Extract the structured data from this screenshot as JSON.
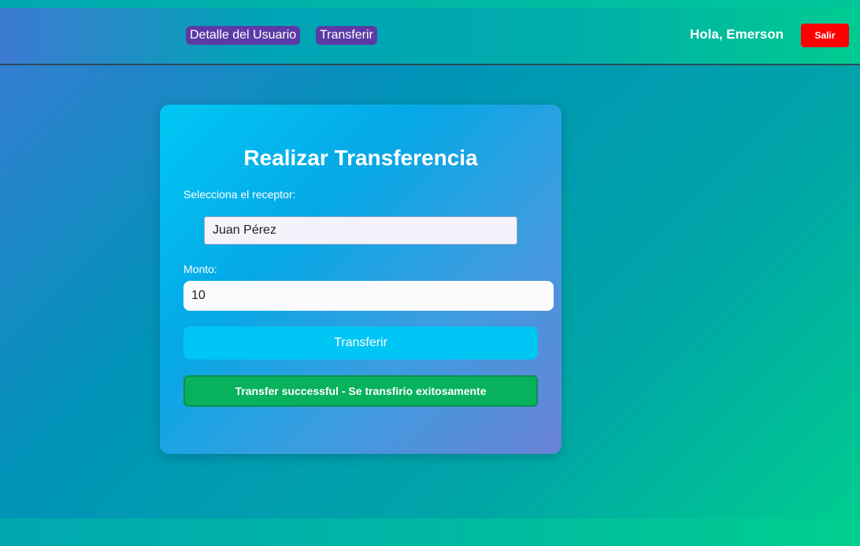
{
  "header": {
    "nav": {
      "user_detail": "Detalle del Usuario",
      "transfer": "Transferir"
    },
    "greeting": "Hola, Emerson",
    "logout_label": "Salir"
  },
  "transfer_form": {
    "title": "Realizar Transferencia",
    "receiver_label": "Selecciona el receptor:",
    "receiver_value": "Juan Pérez",
    "amount_label": "Monto:",
    "amount_value": "10",
    "submit_label": "Transferir",
    "success_message": "Transfer successful - Se transfirio exitosamente"
  },
  "colors": {
    "nav_link_bg": "#5c3aa6",
    "logout_bg": "#ff0000",
    "submit_bg": "#00c6f5",
    "success_bg": "#08b15c"
  }
}
